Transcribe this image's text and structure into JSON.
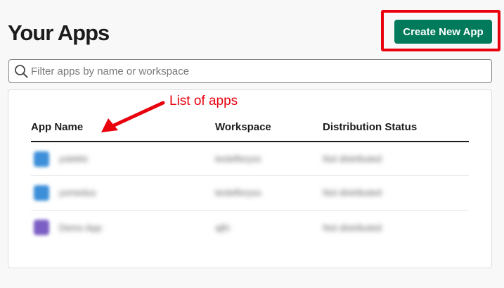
{
  "page": {
    "title": "Your Apps"
  },
  "actions": {
    "create_label": "Create New App"
  },
  "search": {
    "placeholder": "Filter apps by name or workspace",
    "value": ""
  },
  "annotation": {
    "text": "List of apps",
    "color": "#e8000d"
  },
  "table": {
    "columns": [
      "App Name",
      "Workspace",
      "Distribution Status"
    ],
    "rows": [
      {
        "icon": "app-icon",
        "icon_color": "#3d8fd9",
        "name": "yoteklo",
        "workspace": "testeflorysx",
        "status": "Not distributed"
      },
      {
        "icon": "app-icon",
        "icon_color": "#3d8fd9",
        "name": "yomedus",
        "workspace": "testeflorysx",
        "status": "Not distributed"
      },
      {
        "icon": "app-icon",
        "icon_color": "#7b5fc4",
        "name": "Demo App",
        "workspace": "ajfn",
        "status": "Not distributed"
      }
    ]
  },
  "colors": {
    "accent": "#007a5a",
    "highlight": "#e8000d"
  }
}
